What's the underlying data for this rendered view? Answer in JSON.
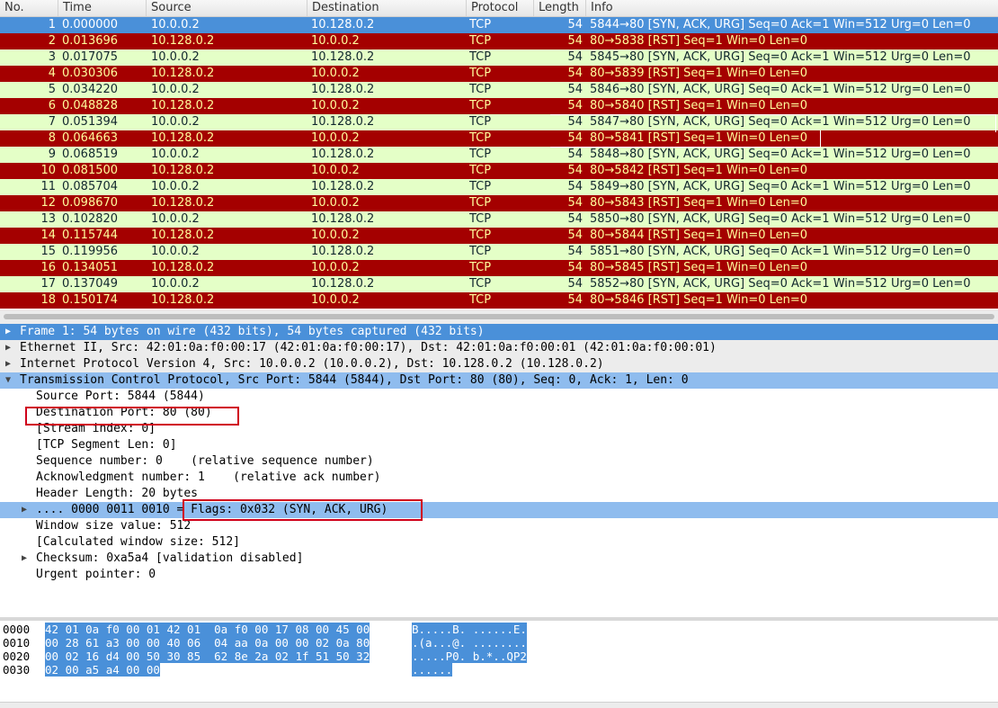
{
  "columns": {
    "no": "No.",
    "time": "Time",
    "source": "Source",
    "destination": "Destination",
    "protocol": "Protocol",
    "length": "Length",
    "info": "Info"
  },
  "packets": [
    {
      "no": "1",
      "time": "0.000000",
      "src": "10.0.0.2",
      "dst": "10.128.0.2",
      "proto": "TCP",
      "len": "54",
      "info": "5844→80 [SYN, ACK, URG] Seq=0 Ack=1 Win=512 Urg=0 Len=0"
    },
    {
      "no": "2",
      "time": "0.013696",
      "src": "10.128.0.2",
      "dst": "10.0.0.2",
      "proto": "TCP",
      "len": "54",
      "info": "80→5838 [RST] Seq=1 Win=0 Len=0"
    },
    {
      "no": "3",
      "time": "0.017075",
      "src": "10.0.0.2",
      "dst": "10.128.0.2",
      "proto": "TCP",
      "len": "54",
      "info": "5845→80 [SYN, ACK, URG] Seq=0 Ack=1 Win=512 Urg=0 Len=0"
    },
    {
      "no": "4",
      "time": "0.030306",
      "src": "10.128.0.2",
      "dst": "10.0.0.2",
      "proto": "TCP",
      "len": "54",
      "info": "80→5839 [RST] Seq=1 Win=0 Len=0"
    },
    {
      "no": "5",
      "time": "0.034220",
      "src": "10.0.0.2",
      "dst": "10.128.0.2",
      "proto": "TCP",
      "len": "54",
      "info": "5846→80 [SYN, ACK, URG] Seq=0 Ack=1 Win=512 Urg=0 Len=0"
    },
    {
      "no": "6",
      "time": "0.048828",
      "src": "10.128.0.2",
      "dst": "10.0.0.2",
      "proto": "TCP",
      "len": "54",
      "info": "80→5840 [RST] Seq=1 Win=0 Len=0"
    },
    {
      "no": "7",
      "time": "0.051394",
      "src": "10.0.0.2",
      "dst": "10.128.0.2",
      "proto": "TCP",
      "len": "54",
      "info": "5847→80 [SYN, ACK, URG] Seq=0 Ack=1 Win=512 Urg=0 Len=0"
    },
    {
      "no": "8",
      "time": "0.064663",
      "src": "10.128.0.2",
      "dst": "10.0.0.2",
      "proto": "TCP",
      "len": "54",
      "info": "80→5841 [RST] Seq=1 Win=0 Len=0"
    },
    {
      "no": "9",
      "time": "0.068519",
      "src": "10.0.0.2",
      "dst": "10.128.0.2",
      "proto": "TCP",
      "len": "54",
      "info": "5848→80 [SYN, ACK, URG] Seq=0 Ack=1 Win=512 Urg=0 Len=0"
    },
    {
      "no": "10",
      "time": "0.081500",
      "src": "10.128.0.2",
      "dst": "10.0.0.2",
      "proto": "TCP",
      "len": "54",
      "info": "80→5842 [RST] Seq=1 Win=0 Len=0"
    },
    {
      "no": "11",
      "time": "0.085704",
      "src": "10.0.0.2",
      "dst": "10.128.0.2",
      "proto": "TCP",
      "len": "54",
      "info": "5849→80 [SYN, ACK, URG] Seq=0 Ack=1 Win=512 Urg=0 Len=0"
    },
    {
      "no": "12",
      "time": "0.098670",
      "src": "10.128.0.2",
      "dst": "10.0.0.2",
      "proto": "TCP",
      "len": "54",
      "info": "80→5843 [RST] Seq=1 Win=0 Len=0"
    },
    {
      "no": "13",
      "time": "0.102820",
      "src": "10.0.0.2",
      "dst": "10.128.0.2",
      "proto": "TCP",
      "len": "54",
      "info": "5850→80 [SYN, ACK, URG] Seq=0 Ack=1 Win=512 Urg=0 Len=0"
    },
    {
      "no": "14",
      "time": "0.115744",
      "src": "10.128.0.2",
      "dst": "10.0.0.2",
      "proto": "TCP",
      "len": "54",
      "info": "80→5844 [RST] Seq=1 Win=0 Len=0"
    },
    {
      "no": "15",
      "time": "0.119956",
      "src": "10.0.0.2",
      "dst": "10.128.0.2",
      "proto": "TCP",
      "len": "54",
      "info": "5851→80 [SYN, ACK, URG] Seq=0 Ack=1 Win=512 Urg=0 Len=0"
    },
    {
      "no": "16",
      "time": "0.134051",
      "src": "10.128.0.2",
      "dst": "10.0.0.2",
      "proto": "TCP",
      "len": "54",
      "info": "80→5845 [RST] Seq=1 Win=0 Len=0"
    },
    {
      "no": "17",
      "time": "0.137049",
      "src": "10.0.0.2",
      "dst": "10.128.0.2",
      "proto": "TCP",
      "len": "54",
      "info": "5852→80 [SYN, ACK, URG] Seq=0 Ack=1 Win=512 Urg=0 Len=0"
    },
    {
      "no": "18",
      "time": "0.150174",
      "src": "10.128.0.2",
      "dst": "10.0.0.2",
      "proto": "TCP",
      "len": "54",
      "info": "80→5846 [RST] Seq=1 Win=0 Len=0"
    }
  ],
  "details": {
    "frame": "Frame 1: 54 bytes on wire (432 bits), 54 bytes captured (432 bits)",
    "ethernet": "Ethernet II, Src: 42:01:0a:f0:00:17 (42:01:0a:f0:00:17), Dst: 42:01:0a:f0:00:01 (42:01:0a:f0:00:01)",
    "ip": "Internet Protocol Version 4, Src: 10.0.0.2 (10.0.0.2), Dst: 10.128.0.2 (10.128.0.2)",
    "tcp": "Transmission Control Protocol, Src Port: 5844 (5844), Dst Port: 80 (80), Seq: 0, Ack: 1, Len: 0",
    "tcp_fields": {
      "src_port": "Source Port: 5844 (5844)",
      "dst_port": "Destination Port: 80 (80)",
      "stream_index": "[Stream index: 0]",
      "segment_len": "[TCP Segment Len: 0]",
      "seq": "Sequence number: 0    (relative sequence number)",
      "ack": "Acknowledgment number: 1    (relative ack number)",
      "header_len": "Header Length: 20 bytes",
      "flags": ".... 0000 0011 0010 = Flags: 0x032 (SYN, ACK, URG)",
      "window": "Window size value: 512",
      "calc_window": "[Calculated window size: 512]",
      "checksum": "Checksum: 0xa5a4 [validation disabled]",
      "urgent": "Urgent pointer: 0"
    }
  },
  "bytes": [
    {
      "offset": "0000",
      "hex": "42 01 0a f0 00 01 42 01  0a f0 00 17 08 00 45 00",
      "ascii": "B.....B. ......E."
    },
    {
      "offset": "0010",
      "hex": "00 28 61 a3 00 00 40 06  04 aa 0a 00 00 02 0a 80",
      "ascii": ".(a...@. ........"
    },
    {
      "offset": "0020",
      "hex": "00 02 16 d4 00 50 30 85  62 8e 2a 02 1f 51 50 32",
      "ascii": ".....P0. b.*..QP2"
    },
    {
      "offset": "0030",
      "hex": "02 00 a5 a4 00 00",
      "ascii": "......"
    }
  ],
  "colors": {
    "syn_row_bg": "#e4ffc7",
    "rst_row_bg": "#a40000",
    "rst_row_fg": "#fffc9c",
    "selection": "#4a90d9",
    "annotation_box": "#d0021b"
  },
  "icons": {
    "collapsed": "triangle-right",
    "expanded": "triangle-down"
  }
}
